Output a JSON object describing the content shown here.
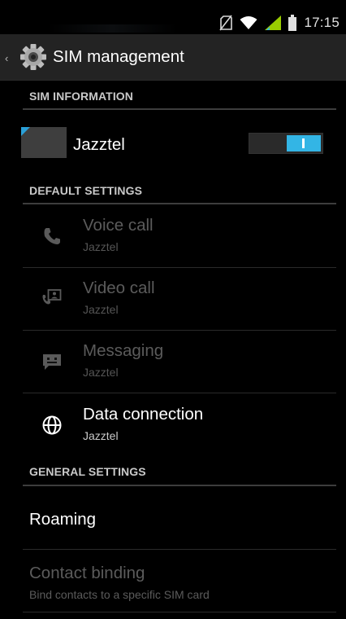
{
  "status_bar": {
    "time": "17:15",
    "icons": [
      "no-sim-icon",
      "wifi-icon",
      "signal-icon",
      "battery-icon"
    ],
    "accent_color": "#33b5e5"
  },
  "action_bar": {
    "title": "SIM management",
    "icon": "gear-icon"
  },
  "sections": {
    "sim_information": "SIM INFORMATION",
    "default_settings": "DEFAULT SETTINGS",
    "general_settings": "GENERAL SETTINGS"
  },
  "sim": {
    "name": "Jazztel",
    "enabled": true,
    "color": "#2aa0d8"
  },
  "default_settings": [
    {
      "title": "Voice call",
      "summary": "Jazztel",
      "icon": "phone-icon",
      "enabled": false
    },
    {
      "title": "Video call",
      "summary": "Jazztel",
      "icon": "video-call-icon",
      "enabled": false
    },
    {
      "title": "Messaging",
      "summary": "Jazztel",
      "icon": "message-icon",
      "enabled": false
    },
    {
      "title": "Data connection",
      "summary": "Jazztel",
      "icon": "globe-icon",
      "enabled": true
    }
  ],
  "general_settings": {
    "roaming": {
      "title": "Roaming"
    },
    "contact_binding": {
      "title": "Contact binding",
      "summary": "Bind contacts to a specific SIM card",
      "enabled": false
    }
  }
}
